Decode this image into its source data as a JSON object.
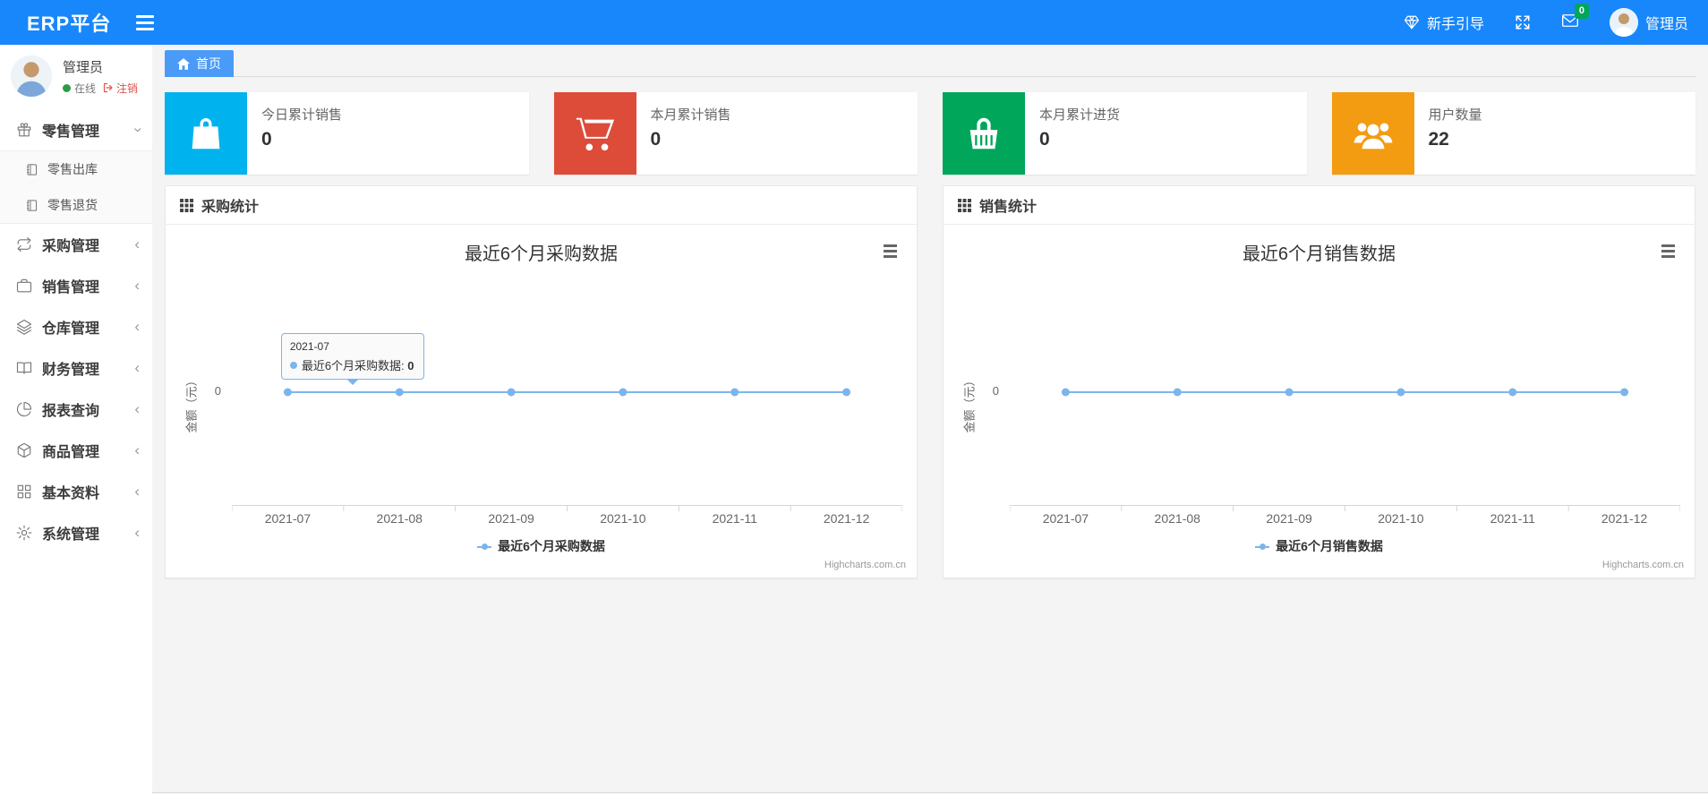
{
  "navbar": {
    "brand": "ERP平台",
    "guide_label": "新手引导",
    "mail_badge": "0",
    "username": "管理员"
  },
  "sidebar": {
    "user": {
      "name": "管理员",
      "status": "在线",
      "logout": "注销"
    },
    "items": [
      {
        "label": "零售管理",
        "icon": "gift-icon",
        "state": "expanded",
        "children": [
          {
            "label": "零售出库",
            "icon": "notebook-icon"
          },
          {
            "label": "零售退货",
            "icon": "notebook-icon"
          }
        ]
      },
      {
        "label": "采购管理",
        "icon": "repeat-icon",
        "state": "collapsed",
        "children": []
      },
      {
        "label": "销售管理",
        "icon": "briefcase-icon",
        "state": "collapsed",
        "children": []
      },
      {
        "label": "仓库管理",
        "icon": "layers-icon",
        "state": "collapsed",
        "children": []
      },
      {
        "label": "财务管理",
        "icon": "book-open-icon",
        "state": "collapsed",
        "children": []
      },
      {
        "label": "报表查询",
        "icon": "pie-chart-icon",
        "state": "collapsed",
        "children": []
      },
      {
        "label": "商品管理",
        "icon": "box-icon",
        "state": "collapsed",
        "children": []
      },
      {
        "label": "基本资料",
        "icon": "grid-icon",
        "state": "collapsed",
        "children": []
      },
      {
        "label": "系统管理",
        "icon": "gear-icon",
        "state": "collapsed",
        "children": []
      }
    ]
  },
  "tabs": {
    "home": "首页"
  },
  "cards": [
    {
      "title": "今日累计销售",
      "value": "0",
      "color": "#00b3ee",
      "icon": "shopping-bag-icon"
    },
    {
      "title": "本月累计销售",
      "value": "0",
      "color": "#dd4b39",
      "icon": "cart-icon"
    },
    {
      "title": "本月累计进货",
      "value": "0",
      "color": "#00a65a",
      "icon": "basket-icon"
    },
    {
      "title": "用户数量",
      "value": "22",
      "color": "#f39c12",
      "icon": "users-icon"
    }
  ],
  "chart_data": [
    {
      "type": "line",
      "panel_title": "采购统计",
      "title": "最近6个月采购数据",
      "x": [
        "2021-07",
        "2021-08",
        "2021-09",
        "2021-10",
        "2021-11",
        "2021-12"
      ],
      "series": [
        {
          "name": "最近6个月采购数据",
          "values": [
            0,
            0,
            0,
            0,
            0,
            0
          ],
          "color": "#7cb5ec"
        }
      ],
      "ylabel": "金额（元）",
      "yticks": [
        "0"
      ],
      "ylim": [
        0,
        0
      ],
      "grid": false,
      "legend_position": "bottom",
      "credit": "Highcharts.com.cn",
      "tooltip": {
        "header": "2021-07",
        "label": "最近6个月采购数据",
        "value": "0",
        "point_index": 0
      }
    },
    {
      "type": "line",
      "panel_title": "销售统计",
      "title": "最近6个月销售数据",
      "x": [
        "2021-07",
        "2021-08",
        "2021-09",
        "2021-10",
        "2021-11",
        "2021-12"
      ],
      "series": [
        {
          "name": "最近6个月销售数据",
          "values": [
            0,
            0,
            0,
            0,
            0,
            0
          ],
          "color": "#7cb5ec"
        }
      ],
      "ylabel": "金额（元）",
      "yticks": [
        "0"
      ],
      "ylim": [
        0,
        0
      ],
      "grid": false,
      "legend_position": "bottom",
      "credit": "Highcharts.com.cn"
    }
  ]
}
